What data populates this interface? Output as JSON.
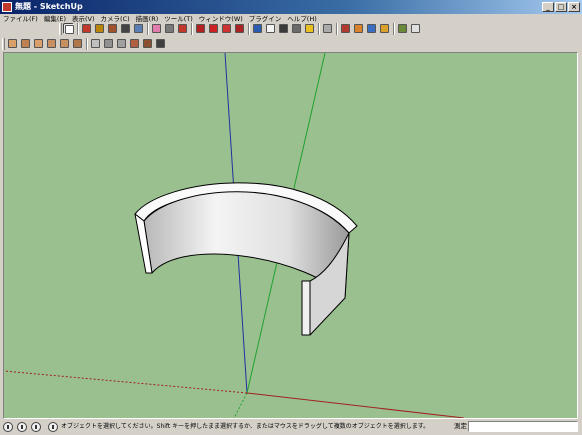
{
  "window": {
    "title": "無題 - SketchUp",
    "controls": [
      "_",
      "□",
      "×"
    ]
  },
  "menu": [
    "ファイル(F)",
    "編集(E)",
    "表示(V)",
    "カメラ(C)",
    "描画(R)",
    "ツール(T)",
    "ウィンドウ(W)",
    "プラグイン",
    "ヘルプ(H)"
  ],
  "toolbar_row1": [
    {
      "name": "select-tool-icon",
      "color": "#ffffff"
    },
    {
      "name": "pencil-tool-icon",
      "color": "#c0392b"
    },
    {
      "name": "rectangle-tool-icon",
      "color": "#b8860b"
    },
    {
      "name": "circle-tool-icon",
      "color": "#a0522d"
    },
    {
      "name": "arc-tool-icon",
      "color": "#444444"
    },
    {
      "name": "make-component-icon",
      "color": "#5a7fb5"
    },
    {
      "name": "eraser-tool-icon",
      "color": "#e27cae"
    },
    {
      "name": "tape-measure-icon",
      "color": "#7a7a7a"
    },
    {
      "name": "paint-bucket-icon",
      "color": "#c0392b"
    },
    {
      "name": "push-pull-icon",
      "color": "#b22222"
    },
    {
      "name": "move-tool-icon",
      "color": "#cc2222"
    },
    {
      "name": "rotate-tool-icon",
      "color": "#cc3333"
    },
    {
      "name": "offset-tool-icon",
      "color": "#aa2222"
    },
    {
      "name": "orbit-tool-icon",
      "color": "#2a5db0"
    },
    {
      "name": "pan-tool-icon",
      "color": "#f2f2f2"
    },
    {
      "name": "zoom-tool-icon",
      "color": "#3a3a3a"
    },
    {
      "name": "zoom-extents-icon",
      "color": "#6a6a6a"
    },
    {
      "name": "previous-view-icon",
      "color": "#e8c020"
    },
    {
      "name": "next-view-icon",
      "color": "#aaaaaa"
    },
    {
      "name": "get-models-icon",
      "color": "#b03a2e"
    },
    {
      "name": "share-model-icon",
      "color": "#d9822b"
    },
    {
      "name": "google-earth-icon",
      "color": "#3a6ec0"
    },
    {
      "name": "place-model-icon",
      "color": "#d9a02b"
    },
    {
      "name": "get-current-view-icon",
      "color": "#6a8a3a"
    },
    {
      "name": "toggle-terrain-icon",
      "color": "#e0e0e0"
    }
  ],
  "toolbar_row2": [
    {
      "name": "iso-view-icon",
      "color": "#d9a06b"
    },
    {
      "name": "top-view-icon",
      "color": "#c08050"
    },
    {
      "name": "front-view-icon",
      "color": "#d9a06b"
    },
    {
      "name": "right-view-icon",
      "color": "#c89060"
    },
    {
      "name": "back-view-icon",
      "color": "#c89060"
    },
    {
      "name": "left-view-icon",
      "color": "#b07848"
    },
    {
      "name": "xray-style-icon",
      "color": "#c0c0c0"
    },
    {
      "name": "wireframe-style-icon",
      "color": "#909090"
    },
    {
      "name": "hidden-line-style-icon",
      "color": "#a0a0a0"
    },
    {
      "name": "shaded-style-icon",
      "color": "#b06040"
    },
    {
      "name": "shaded-textures-style-icon",
      "color": "#8a5030"
    },
    {
      "name": "monochrome-style-icon",
      "color": "#404040"
    }
  ],
  "scene": {
    "background": "#9bc08f",
    "axis_colors": {
      "blue": "#2030a0",
      "green": "#20a030",
      "red": "#a02020"
    },
    "shape": "open cylindrical wall (C-shaped)"
  },
  "status": {
    "icons": [
      "geo-location-icon",
      "credits-icon",
      "help-icon"
    ],
    "text": "オブジェクトを選択してください。Shift キーを押したまま選択するか、またはマウスをドラッグして複数のオブジェクトを選択します。",
    "measure_label": "測定",
    "measure_value": ""
  }
}
